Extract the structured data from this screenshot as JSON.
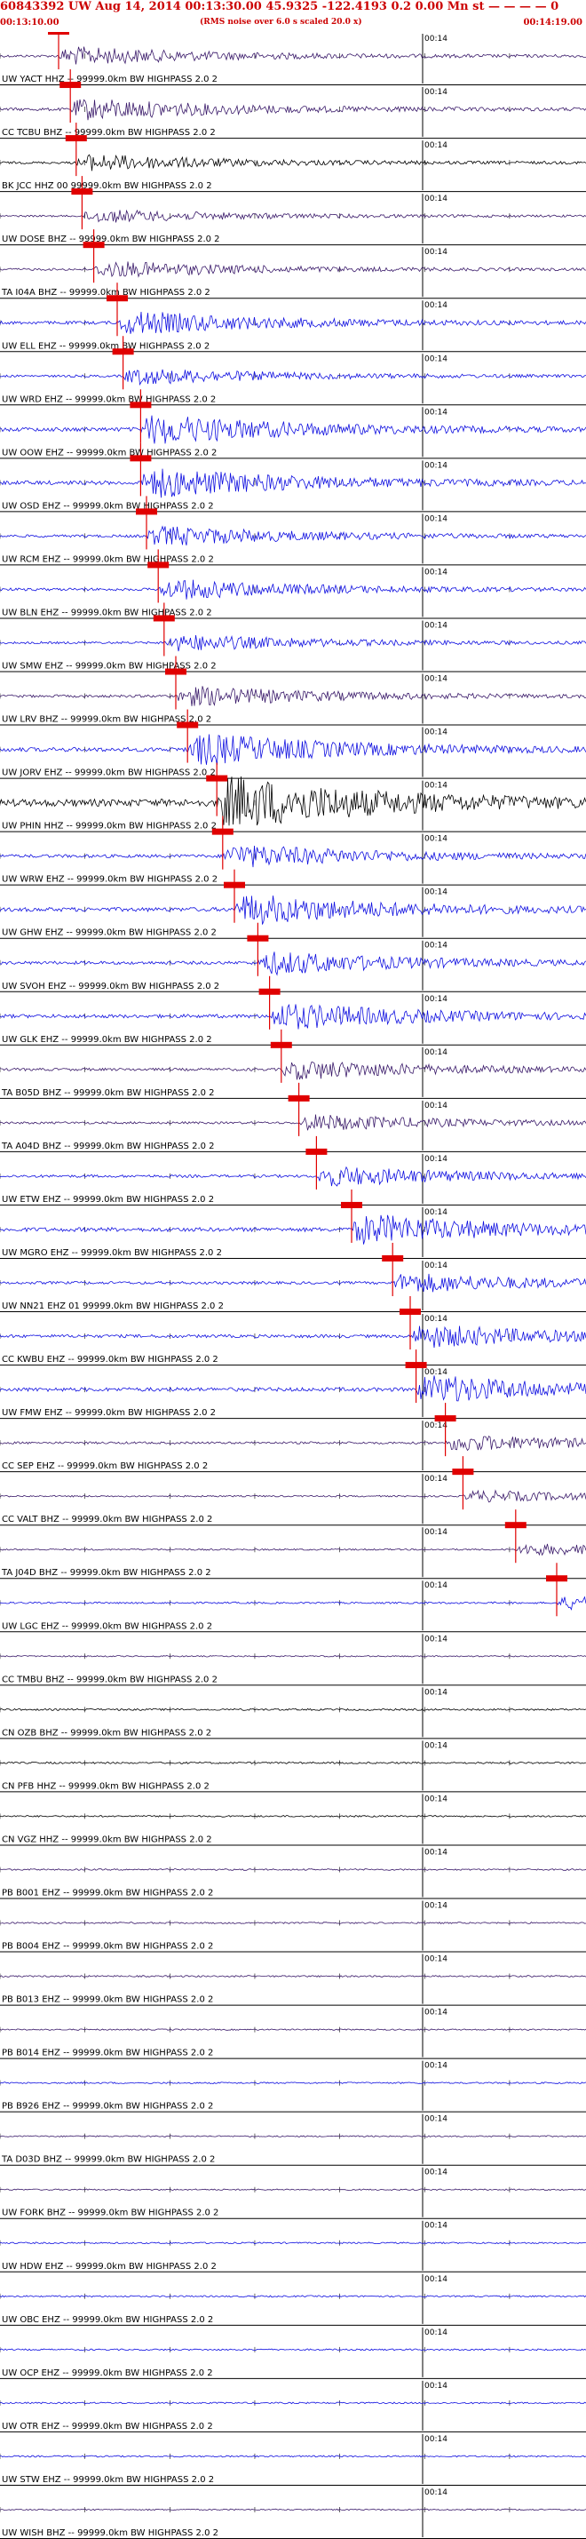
{
  "header": {
    "title": "60843392 UW Aug 14, 2014 00:13:30.00   45.9325 -122.4193  0.2 0.00 Mn st — — — — 0",
    "start_time": "00:13:10.00",
    "subtitle": "(RMS noise over 6.0 s scaled 20.0 x)",
    "end_time": "00:14:19.00"
  },
  "minute_label": "00:14",
  "colors": {
    "trace_blue": "#1010e0",
    "trace_purple": "#3a1a6a",
    "trace_black": "#000000",
    "pick": "#e00000",
    "divider": "#000000",
    "header_text": "#cc0000"
  },
  "traces": [
    {
      "label": "UW YACT HHZ -- 99999.0km BW HIGHPASS  2.0  2",
      "pick": 0.1,
      "color": "purple",
      "amp": 0.55
    },
    {
      "label": "CC TCBU BHZ -- 99999.0km BW HIGHPASS  2.0  2",
      "pick": 0.12,
      "color": "purple",
      "amp": 0.65
    },
    {
      "label": "BK JCC HHZ 00 99999.0km BW HIGHPASS  2.0  2",
      "pick": 0.13,
      "color": "black",
      "amp": 0.5
    },
    {
      "label": "UW DOSE BHZ -- 99999.0km BW HIGHPASS  2.0  2",
      "pick": 0.14,
      "color": "purple",
      "amp": 0.4
    },
    {
      "label": "TA I04A BHZ -- 99999.0km BW HIGHPASS  2.0  2",
      "pick": 0.16,
      "color": "purple",
      "amp": 0.5
    },
    {
      "label": "UW ELL EHZ -- 99999.0km BW HIGHPASS  2.0  2",
      "pick": 0.2,
      "color": "blue",
      "amp": 0.7
    },
    {
      "label": "UW WRD EHZ -- 99999.0km BW HIGHPASS  2.0  2",
      "pick": 0.21,
      "color": "blue",
      "amp": 0.5
    },
    {
      "label": "UW OOW EHZ -- 99999.0km BW HIGHPASS  2.0  2",
      "pick": 0.24,
      "color": "blue",
      "amp": 0.9
    },
    {
      "label": "UW OSD EHZ -- 99999.0km BW HIGHPASS  2.0  2",
      "pick": 0.24,
      "color": "blue",
      "amp": 0.9
    },
    {
      "label": "UW RCM EHZ -- 99999.0km BW HIGHPASS  2.0  2",
      "pick": 0.25,
      "color": "blue",
      "amp": 0.6
    },
    {
      "label": "UW BLN EHZ -- 99999.0km BW HIGHPASS  2.0  2",
      "pick": 0.27,
      "color": "blue",
      "amp": 0.6
    },
    {
      "label": "UW SMW EHZ -- 99999.0km BW HIGHPASS  2.0  2",
      "pick": 0.28,
      "color": "blue",
      "amp": 0.5
    },
    {
      "label": "UW LRV BHZ -- 99999.0km BW HIGHPASS  2.0  2",
      "pick": 0.3,
      "color": "purple",
      "amp": 0.6
    },
    {
      "label": "UW JORV EHZ -- 99999.0km BW HIGHPASS  2.0  2",
      "pick": 0.32,
      "color": "blue",
      "amp": 0.95
    },
    {
      "label": "UW PHIN HHZ -- 99999.0km BW HIGHPASS  2.0  2",
      "pick": 0.37,
      "color": "black",
      "amp": 1.6
    },
    {
      "label": "UW WRW EHZ -- 99999.0km BW HIGHPASS  2.0  2",
      "pick": 0.38,
      "color": "blue",
      "amp": 0.7
    },
    {
      "label": "UW GHW EHZ -- 99999.0km BW HIGHPASS  2.0  2",
      "pick": 0.4,
      "color": "blue",
      "amp": 0.9
    },
    {
      "label": "UW SVOH EHZ -- 99999.0km BW HIGHPASS  2.0  2",
      "pick": 0.44,
      "color": "blue",
      "amp": 0.7
    },
    {
      "label": "UW GLK EHZ -- 99999.0km BW HIGHPASS  2.0  2",
      "pick": 0.46,
      "color": "blue",
      "amp": 0.8
    },
    {
      "label": "TA B05D BHZ -- 99999.0km BW HIGHPASS  2.0  2",
      "pick": 0.48,
      "color": "purple",
      "amp": 0.6
    },
    {
      "label": "TA A04D BHZ -- 99999.0km BW HIGHPASS  2.0  2",
      "pick": 0.51,
      "color": "purple",
      "amp": 0.5
    },
    {
      "label": "UW ETW EHZ -- 99999.0km BW HIGHPASS  2.0  2",
      "pick": 0.54,
      "color": "blue",
      "amp": 0.6
    },
    {
      "label": "UW MGRO EHZ -- 99999.0km BW HIGHPASS  2.0  2",
      "pick": 0.6,
      "color": "blue",
      "amp": 0.9
    },
    {
      "label": "UW NN21 EHZ 01 99999.0km BW HIGHPASS  2.0  2",
      "pick": 0.67,
      "color": "blue",
      "amp": 0.6
    },
    {
      "label": "CC KWBU EHZ -- 99999.0km BW HIGHPASS  2.0  2",
      "pick": 0.7,
      "color": "blue",
      "amp": 0.7
    },
    {
      "label": "UW FMW EHZ -- 99999.0km BW HIGHPASS  2.0  2",
      "pick": 0.71,
      "color": "blue",
      "amp": 0.85
    },
    {
      "label": "CC SEP EHZ -- 99999.0km BW HIGHPASS  2.0  2",
      "pick": 0.76,
      "color": "purple",
      "amp": 0.5
    },
    {
      "label": "CC VALT BHZ -- 99999.0km BW HIGHPASS  2.0  2",
      "pick": 0.79,
      "color": "purple",
      "amp": 0.35
    },
    {
      "label": "TA J04D BHZ -- 99999.0km BW HIGHPASS  2.0  2",
      "pick": 0.88,
      "color": "purple",
      "amp": 0.35
    },
    {
      "label": "UW LGC EHZ -- 99999.0km BW HIGHPASS  2.0  2",
      "pick": 0.95,
      "color": "blue",
      "amp": 0.4
    },
    {
      "label": "CC TMBU BHZ -- 99999.0km BW HIGHPASS  2.0  2",
      "pick": null,
      "color": "purple",
      "amp": 0.3
    },
    {
      "label": "CN OZB BHZ -- 99999.0km BW HIGHPASS  2.0  2",
      "pick": null,
      "color": "black",
      "amp": 0.4
    },
    {
      "label": "CN PFB HHZ -- 99999.0km BW HIGHPASS  2.0  2",
      "pick": null,
      "color": "black",
      "amp": 0.4
    },
    {
      "label": "CN VGZ HHZ -- 99999.0km BW HIGHPASS  2.0  2",
      "pick": null,
      "color": "black",
      "amp": 0.35
    },
    {
      "label": "PB B001 EHZ -- 99999.0km BW HIGHPASS  2.0  2",
      "pick": null,
      "color": "purple",
      "amp": 0.35
    },
    {
      "label": "PB B004 EHZ -- 99999.0km BW HIGHPASS  2.0  2",
      "pick": null,
      "color": "purple",
      "amp": 0.35
    },
    {
      "label": "PB B013 EHZ -- 99999.0km BW HIGHPASS  2.0  2",
      "pick": null,
      "color": "purple",
      "amp": 0.35
    },
    {
      "label": "PB B014 EHZ -- 99999.0km BW HIGHPASS  2.0  2",
      "pick": null,
      "color": "purple",
      "amp": 0.3
    },
    {
      "label": "PB B926 EHZ -- 99999.0km BW HIGHPASS  2.0  2",
      "pick": null,
      "color": "blue",
      "amp": 0.35
    },
    {
      "label": "TA D03D BHZ -- 99999.0km BW HIGHPASS  2.0  2",
      "pick": null,
      "color": "purple",
      "amp": 0.3
    },
    {
      "label": "UW FORK BHZ -- 99999.0km BW HIGHPASS  2.0  2",
      "pick": null,
      "color": "purple",
      "amp": 0.3
    },
    {
      "label": "UW HDW EHZ -- 99999.0km BW HIGHPASS  2.0  2",
      "pick": null,
      "color": "blue",
      "amp": 0.35
    },
    {
      "label": "UW OBC EHZ -- 99999.0km BW HIGHPASS  2.0  2",
      "pick": null,
      "color": "blue",
      "amp": 0.35
    },
    {
      "label": "UW OCP EHZ -- 99999.0km BW HIGHPASS  2.0  2",
      "pick": null,
      "color": "blue",
      "amp": 0.35
    },
    {
      "label": "UW OTR EHZ -- 99999.0km BW HIGHPASS  2.0  2",
      "pick": null,
      "color": "blue",
      "amp": 0.35
    },
    {
      "label": "UW STW EHZ -- 99999.0km BW HIGHPASS  2.0  2",
      "pick": null,
      "color": "blue",
      "amp": 0.35
    },
    {
      "label": "UW WISH BHZ -- 99999.0km BW HIGHPASS  2.0  2",
      "pick": null,
      "color": "purple",
      "amp": 0.3
    }
  ]
}
